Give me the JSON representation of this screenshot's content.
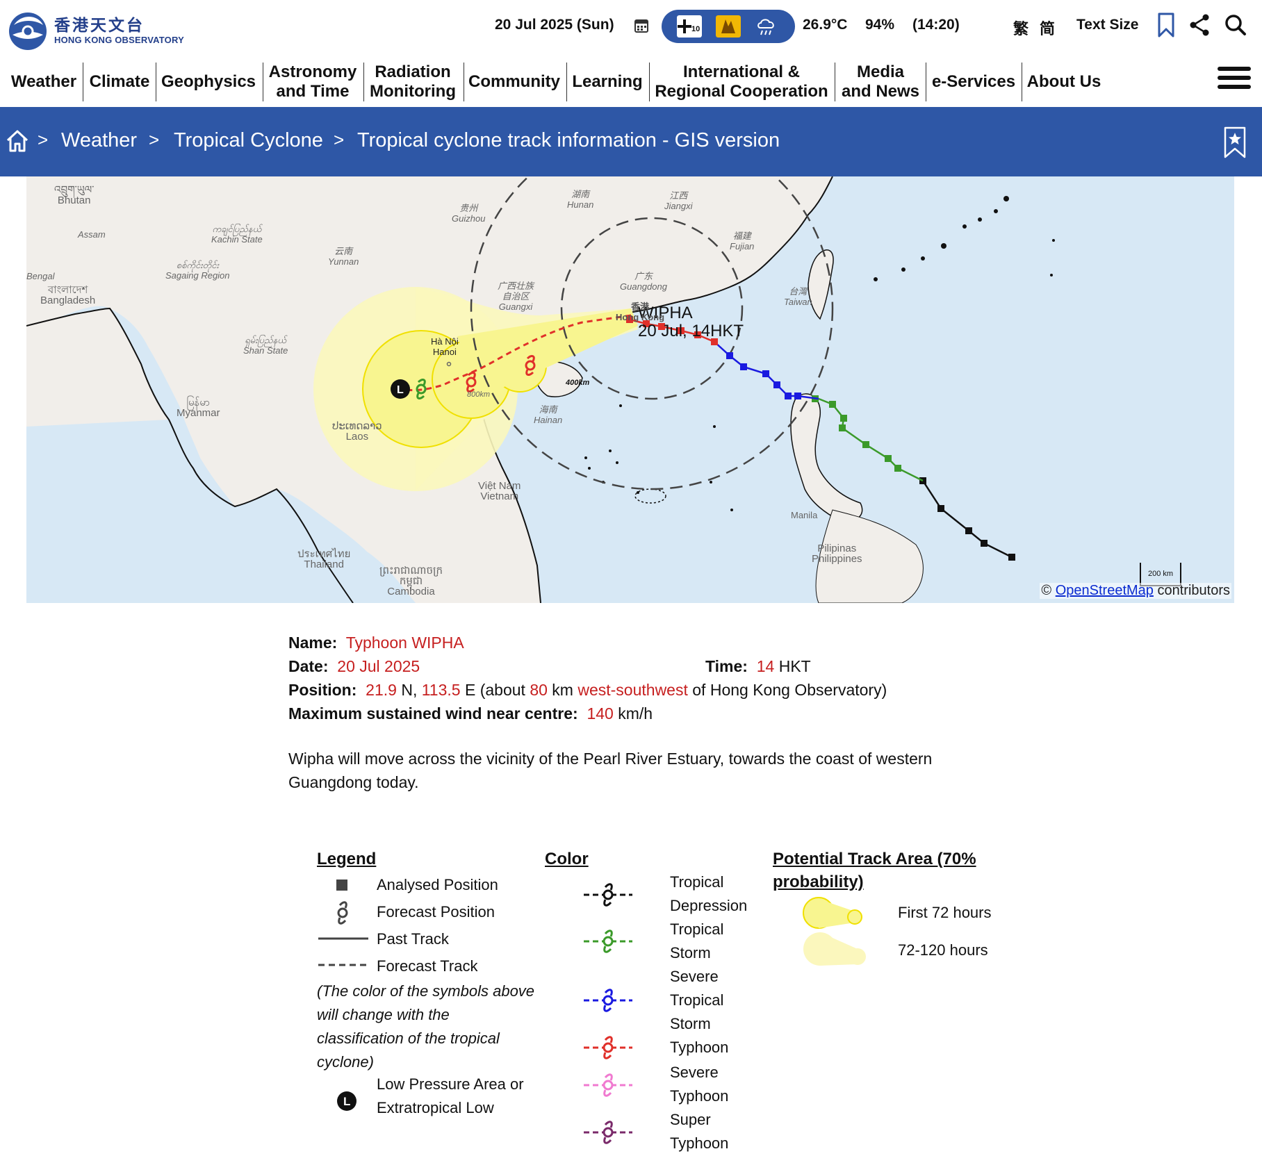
{
  "header": {
    "logo_zh": "香港天文台",
    "logo_en": "HONG KONG OBSERVATORY",
    "date": "20 Jul 2025 (Sun)",
    "temperature": "26.9°C",
    "humidity": "94%",
    "obs_time": "(14:20)",
    "lang_tc": "繁",
    "lang_sc": "简",
    "text_size": "Text Size",
    "icons": [
      "calendar-icon",
      "signal-10-icon",
      "warning-icon",
      "rain-icon",
      "bookmark-icon",
      "share-icon",
      "search-icon"
    ]
  },
  "nav": {
    "items": [
      {
        "label": "Weather"
      },
      {
        "label": "Climate"
      },
      {
        "label": "Geophysics"
      },
      {
        "label": "Astronomy\nand Time"
      },
      {
        "label": "Radiation\nMonitoring"
      },
      {
        "label": "Community"
      },
      {
        "label": "Learning"
      },
      {
        "label": "International &\nRegional Cooperation"
      },
      {
        "label": "Media\nand News"
      },
      {
        "label": "e-Services"
      },
      {
        "label": "About Us"
      }
    ]
  },
  "breadcrumb": {
    "sep": ">",
    "items": [
      "Weather",
      "Tropical Cyclone",
      "Tropical cyclone track information - GIS version"
    ]
  },
  "map": {
    "storm_label_line1": "WIPHA",
    "storm_label_line2": "20 Jul, 14HKT",
    "radius_label_1": "400km",
    "radius_label_2": "800km",
    "scale": "200 km",
    "attribution_prefix": "©",
    "attribution_link": "OpenStreetMap",
    "attribution_suffix": "contributors",
    "place_labels": [
      {
        "text": "འབྲུག་ཡུལ་\nBhutan"
      },
      {
        "text": "Assam"
      },
      {
        "text": "ကချင်ပြည်နယ်\nKachin State"
      },
      {
        "text": "贵州\nGuizhou"
      },
      {
        "text": "湖南\nHunan"
      },
      {
        "text": "江西\nJiangxi"
      },
      {
        "text": "福建\nFujian"
      },
      {
        "text": "云南\nYunnan"
      },
      {
        "text": "Bengal"
      },
      {
        "text": "বাংলাদেশ\nBangladesh"
      },
      {
        "text": "စစ်ကိုင်းတိုင်း\nSagaing Region"
      },
      {
        "text": "广西壮族\n自治区\nGuangxi"
      },
      {
        "text": "广东\nGuangdong"
      },
      {
        "text": "台灣\nTaiwan"
      },
      {
        "text": "香港\nHong Kong"
      },
      {
        "text": "Hà Nội\nHanoi"
      },
      {
        "text": "ရှမ်းပြည်နယ်\nShan State"
      },
      {
        "text": "မြန်မာ\nMyanmar"
      },
      {
        "text": "海南\nHainan"
      },
      {
        "text": "ປະເທດລາວ\nLaos"
      },
      {
        "text": "Việt Nam\nVietnam"
      },
      {
        "text": "Manila"
      },
      {
        "text": "Pilipinas\nPhilippines"
      },
      {
        "text": "ประเทศไทย\nThailand"
      },
      {
        "text": "ព្រះរាជាណាចក្រ\nកម្ពុជា\nCambodia"
      }
    ]
  },
  "info": {
    "name_label": "Name:",
    "name_value": "Typhoon WIPHA",
    "date_label": "Date:",
    "date_value": "20 Jul 2025",
    "time_label": "Time:",
    "time_value": "14",
    "time_unit": "HKT",
    "position_label": "Position:",
    "lat": "21.9",
    "lat_dir": "N,",
    "lon": "113.5",
    "lon_dir": "E (about",
    "distance": "80",
    "distance_unit": "km",
    "direction": "west-southwest",
    "position_suffix": "of Hong Kong Observatory)",
    "wind_label": "Maximum sustained wind near centre:",
    "wind_value": "140",
    "wind_unit": "km/h",
    "description": "Wipha will move across the vicinity of the Pearl River Estuary, towards the coast of western Guangdong today."
  },
  "legend": {
    "title": "Legend",
    "items": [
      "Analysed Position",
      "Forecast Position",
      "Past Track",
      "Forecast Track"
    ],
    "note": "(The color of the symbols above will change with the classification of the tropical cyclone)",
    "low_label": "Low Pressure Area or Extratropical Low",
    "color_title": "Color",
    "colors": [
      {
        "name": "Tropical Depression",
        "color": "#111111"
      },
      {
        "name": "Tropical Storm",
        "color": "#3b9a2a"
      },
      {
        "name": "Severe Tropical Storm",
        "color": "#1a1ae0"
      },
      {
        "name": "Typhoon",
        "color": "#e0302a"
      },
      {
        "name": "Severe Typhoon",
        "color": "#f07ad0"
      },
      {
        "name": "Super Typhoon",
        "color": "#7a2a6a"
      }
    ],
    "area_title": "Potential Track Area (70% probability)",
    "area_items": [
      "First 72 hours",
      "72-120 hours"
    ]
  },
  "colors": {
    "brand": "#2e57a6",
    "highlight": "#c61f1f"
  }
}
